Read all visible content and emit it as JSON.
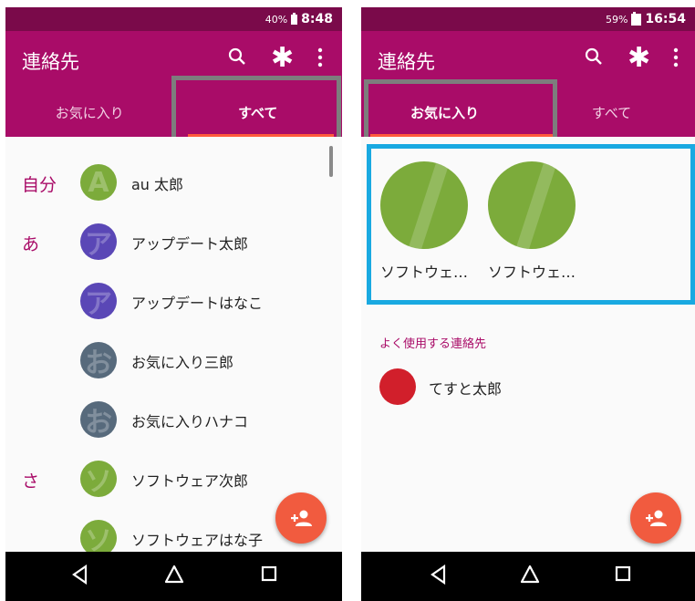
{
  "left_screen": {
    "status": {
      "battery": "40%",
      "time": "8:48"
    },
    "app_title": "連絡先",
    "tabs": [
      {
        "label": "お気に入り",
        "active": false
      },
      {
        "label": "すべて",
        "active": true
      }
    ],
    "contacts": [
      {
        "section": "自分",
        "name": "au 太郎",
        "avatar_color": "#7cab3b",
        "avatar_glyph": "A"
      },
      {
        "section": "あ",
        "name": "アップデート太郎",
        "avatar_color": "#5a47b6",
        "avatar_glyph": "ア"
      },
      {
        "section": "",
        "name": "アップデートはなこ",
        "avatar_color": "#5a47b6",
        "avatar_glyph": "ア"
      },
      {
        "section": "",
        "name": "お気に入り三郎",
        "avatar_color": "#576a7c",
        "avatar_glyph": "お"
      },
      {
        "section": "",
        "name": "お気に入りハナコ",
        "avatar_color": "#576a7c",
        "avatar_glyph": "お"
      },
      {
        "section": "さ",
        "name": "ソフトウェア次郎",
        "avatar_color": "#7cab3b",
        "avatar_glyph": "ソ"
      },
      {
        "section": "",
        "name": "ソフトウェアはな子",
        "avatar_color": "#7cab3b",
        "avatar_glyph": "ソ"
      }
    ]
  },
  "right_screen": {
    "status": {
      "battery": "59%",
      "time": "16:54"
    },
    "app_title": "連絡先",
    "tabs": [
      {
        "label": "お気に入り",
        "active": true
      },
      {
        "label": "すべて",
        "active": false
      }
    ],
    "favorites": [
      {
        "name": "ソフトウェ…",
        "avatar_color": "#7cab3b"
      },
      {
        "name": "ソフトウェ…",
        "avatar_color": "#7cab3b"
      }
    ],
    "frequent_heading": "よく使用する連絡先",
    "frequent": [
      {
        "name": "てすと太郎",
        "avatar_color": "#d11f2b"
      }
    ]
  },
  "colors": {
    "appbar": "#a90c68",
    "statusbar": "#7a0a4a",
    "fab": "#f15b3f",
    "highlight_gray": "#7d7d7d",
    "highlight_blue": "#19a9e1"
  },
  "icons": {
    "search": "search-icon",
    "asterisk": "asterisk-icon",
    "menu": "overflow-menu-icon",
    "fab": "add-contact-icon",
    "back": "back-icon",
    "home": "home-icon",
    "recents": "recents-icon"
  }
}
